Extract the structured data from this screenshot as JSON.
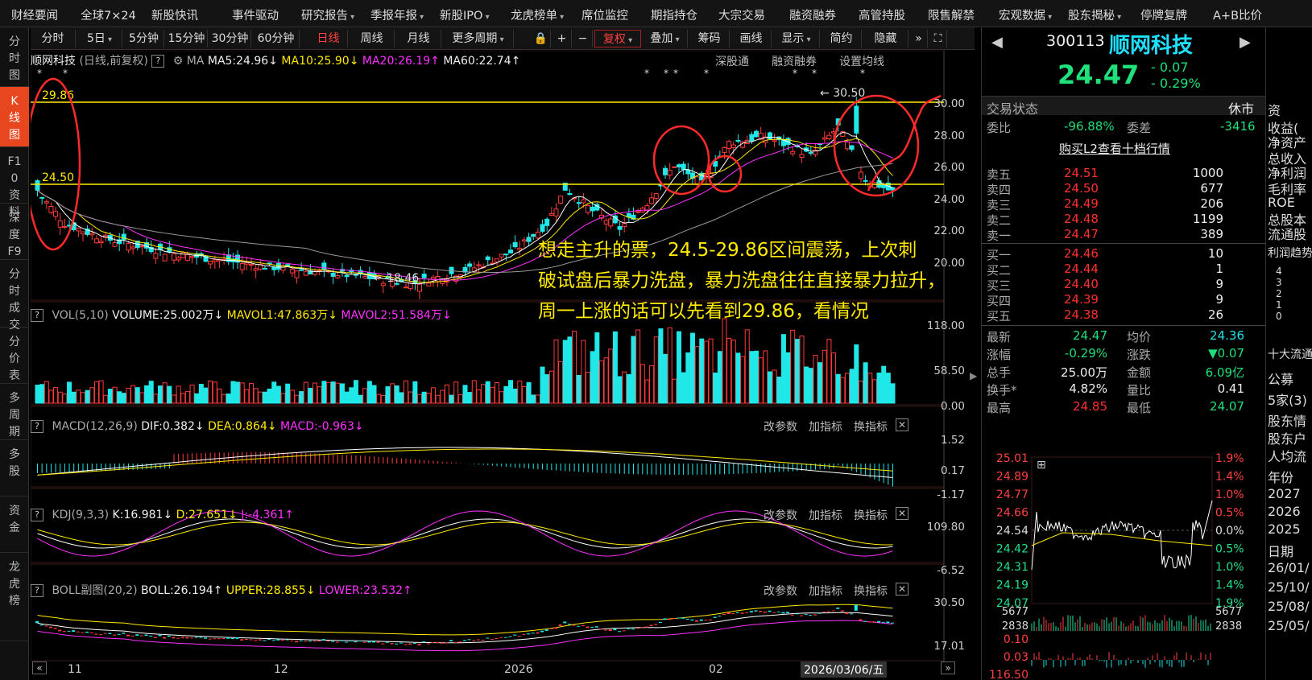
{
  "nav": [
    "财经要闻",
    "全球7×24",
    "新股快讯",
    "事件驱动",
    "研究报告",
    "季报年报",
    "新股IPO",
    "龙虎榜单",
    "席位监控",
    "期指持仓",
    "大宗交易",
    "融资融券",
    "高管持股",
    "限售解禁",
    "宏观数据",
    "股东揭秘",
    "停牌复牌",
    "A+B比价"
  ],
  "nav_dropdown": [
    "研究报告",
    "季报年报",
    "新股IPO",
    "龙虎榜单",
    "宏观数据",
    "股东揭秘"
  ],
  "leftbar": [
    "分时图",
    "K线图",
    "F10资料",
    "深度F9",
    "分时成交",
    "分价表",
    "多周期",
    "多股",
    "资金",
    "龙虎榜"
  ],
  "toolbar": {
    "periods": [
      "分时",
      "5日",
      "5分钟",
      "15分钟",
      "30分钟",
      "60分钟",
      "日线",
      "周线",
      "月线",
      "更多周期"
    ],
    "tools": [
      "复权",
      "叠加",
      "筹码",
      "画线",
      "显示",
      "简约",
      "隐藏"
    ]
  },
  "ma_header": {
    "name": "顺网科技",
    "mode": "(日线,前复权)",
    "label": "MA",
    "ma5": "MA5:24.96",
    "ma10": "MA10:25.90",
    "ma20": "MA20:26.19",
    "ma60": "MA60:22.74",
    "links": [
      "深股通",
      "融资融券",
      "设置均线"
    ]
  },
  "vol_header": {
    "label": "VOL(5,10)",
    "volume": "VOLUME:25.002万",
    "mavol1": "MAVOL1:47.863万",
    "mavol2": "MAVOL2:51.584万"
  },
  "macd_header": {
    "label": "MACD(12,26,9)",
    "dif": "DIF:0.382",
    "dea": "DEA:0.864",
    "macd": "MACD:-0.963"
  },
  "kdj_header": {
    "label": "KDJ(9,3,3)",
    "k": "K:16.981",
    "d": "D:27.651",
    "j": "J:-4.361"
  },
  "boll_header": {
    "label": "BOLL副图(20,2)",
    "boll": "BOLL:26.194",
    "upper": "UPPER:28.855",
    "lower": "LOWER:23.532"
  },
  "indicator_links": [
    "改参数",
    "加指标",
    "换指标"
  ],
  "price_axis": [
    "30.00",
    "28.00",
    "26.00",
    "24.00",
    "22.00",
    "20.00"
  ],
  "vol_axis": [
    "118.00",
    "58.50",
    "0.00"
  ],
  "macd_axis": [
    "1.52",
    "0.17",
    "-1.17"
  ],
  "kdj_axis": [
    "109.80",
    "-6.52"
  ],
  "boll_axis": [
    "30.50",
    "17.01"
  ],
  "date_axis": [
    "11",
    "12",
    "2026",
    "02"
  ],
  "cursor_date": "2026/03/06/五",
  "price_lines": {
    "upper": "29.86",
    "lower": "24.50",
    "high_mark": "30.50",
    "low_mark": "18.46"
  },
  "annotation": [
    "想走主升的票，24.5-29.86区间震荡，上次刺",
    "破试盘后暴力洗盘，暴力洗盘往往直接暴力拉升，",
    "周一上涨的话可以先看到29.86，看情况"
  ],
  "quote": {
    "code": "300113",
    "name": "顺网科技",
    "price": "24.47",
    "change": "- 0.07",
    "pct": "- 0.29%",
    "status_label": "交易状态",
    "status": "休市",
    "weibi_label": "委比",
    "weibi": "-96.88%",
    "weicha_label": "委差",
    "weicha": "-3416",
    "l2_link": "购买L2查看十档行情"
  },
  "asks": [
    {
      "label": "卖五",
      "price": "24.51",
      "vol": "1000"
    },
    {
      "label": "卖四",
      "price": "24.50",
      "vol": "677"
    },
    {
      "label": "卖三",
      "price": "24.49",
      "vol": "206"
    },
    {
      "label": "卖二",
      "price": "24.48",
      "vol": "1199"
    },
    {
      "label": "卖一",
      "price": "24.47",
      "vol": "389"
    }
  ],
  "bids": [
    {
      "label": "买一",
      "price": "24.46",
      "vol": "10"
    },
    {
      "label": "买二",
      "price": "24.44",
      "vol": "1"
    },
    {
      "label": "买三",
      "price": "24.40",
      "vol": "9"
    },
    {
      "label": "买四",
      "price": "24.39",
      "vol": "9"
    },
    {
      "label": "买五",
      "price": "24.38",
      "vol": "26"
    }
  ],
  "stats": [
    {
      "l1": "最新",
      "v1": "24.47",
      "l2": "均价",
      "v2": "24.36"
    },
    {
      "l1": "涨幅",
      "v1": "-0.29%",
      "l2": "涨跌",
      "v2": "▼0.07"
    },
    {
      "l1": "总手",
      "v1": "25.00万",
      "l2": "金额",
      "v2": "6.09亿"
    },
    {
      "l1": "换手*",
      "v1": "4.82%",
      "l2": "量比",
      "v2": "0.41"
    },
    {
      "l1": "最高",
      "v1": "24.85",
      "l2": "最低",
      "v2": "24.07"
    }
  ],
  "mini_left_axis": [
    "25.01",
    "24.89",
    "24.77",
    "24.66",
    "24.54",
    "24.42",
    "24.31",
    "24.19",
    "24.07"
  ],
  "mini_right_axis": [
    "1.9%",
    "1.4%",
    "1.0%",
    "0.5%",
    "0.0%",
    "0.5%",
    "1.0%",
    "1.4%",
    "1.9%"
  ],
  "mini_vol_axis": [
    "5677",
    "2838"
  ],
  "mini_bottom_left": [
    "0.10",
    "0.03",
    "116.50"
  ],
  "farright": [
    "资",
    "收益(",
    "净资产",
    "总收入",
    "净利润",
    "毛利率",
    "ROE",
    "总股本",
    "流通股",
    "利润趋势",
    "4",
    "3",
    "2",
    "1",
    "0",
    "十大流通",
    "公募",
    "5家(3)",
    "股东情",
    "股东户",
    "人均流",
    "年份",
    "2027",
    "2026",
    "2025",
    "日期",
    "26/01/",
    "25/10/",
    "25/08/",
    "25/05/"
  ],
  "colors": {
    "up": "#ff3a3a",
    "down": "#20e8e8",
    "ma5": "#ffffff",
    "ma10": "#ffea00",
    "ma20": "#ff30ff",
    "ma60": "#999999",
    "line": "#ffea00",
    "circle": "#ff2a2a"
  }
}
